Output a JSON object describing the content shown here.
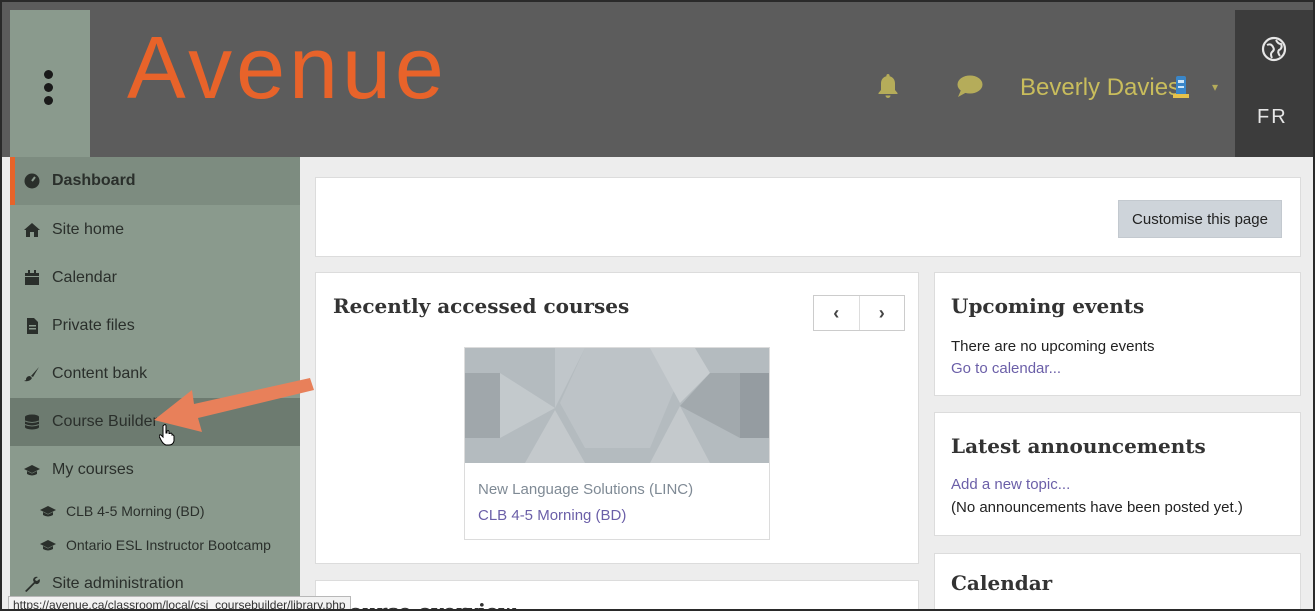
{
  "header": {
    "logo_text": "Avenue",
    "user_name": "Beverly Davies",
    "lang_label": "FR",
    "icons": {
      "menu": "vertical-dots-icon",
      "notifications": "bell-icon",
      "messages": "chat-bubble-icon",
      "language": "globe-icon",
      "avatar": "user-avatar-icon"
    },
    "colors": {
      "bar": "#5c5c5c",
      "logo": "#e8632a",
      "user": "#c9bd5c",
      "notif": "#b5ac5a"
    }
  },
  "sidebar": {
    "items": [
      {
        "label": "Dashboard",
        "icon": "dashboard-icon",
        "active": true
      },
      {
        "label": "Site home",
        "icon": "home-icon"
      },
      {
        "label": "Calendar",
        "icon": "calendar-icon"
      },
      {
        "label": "Private files",
        "icon": "file-icon"
      },
      {
        "label": "Content bank",
        "icon": "brush-icon"
      },
      {
        "label": "Course Builder",
        "icon": "database-icon",
        "hovered": true
      },
      {
        "label": "My courses",
        "icon": "graduation-cap-icon"
      },
      {
        "label": "CLB 4-5 Morning (BD)",
        "icon": "graduation-cap-icon"
      },
      {
        "label": "Ontario ESL Instructor Bootcamp",
        "icon": "graduation-cap-icon"
      },
      {
        "label": "Site administration",
        "icon": "wrench-icon"
      }
    ],
    "accent": "#e8632a"
  },
  "status_url": "https://avenue.ca/classroom/local/csi_coursebuilder/library.php",
  "main": {
    "customise_label": "Customise this page",
    "recent": {
      "title": "Recently accessed courses",
      "prev": "‹",
      "next": "›",
      "course_category": "New Language Solutions (LINC)",
      "course_name": "CLB 4-5 Morning (BD)"
    },
    "overview_title": "Course overview",
    "events": {
      "title": "Upcoming events",
      "empty_text": "There are no upcoming events",
      "link": "Go to calendar..."
    },
    "announcements": {
      "title": "Latest announcements",
      "link": "Add a new topic...",
      "empty_text": "(No announcements have been posted yet.)"
    },
    "calendar_title": "Calendar"
  }
}
